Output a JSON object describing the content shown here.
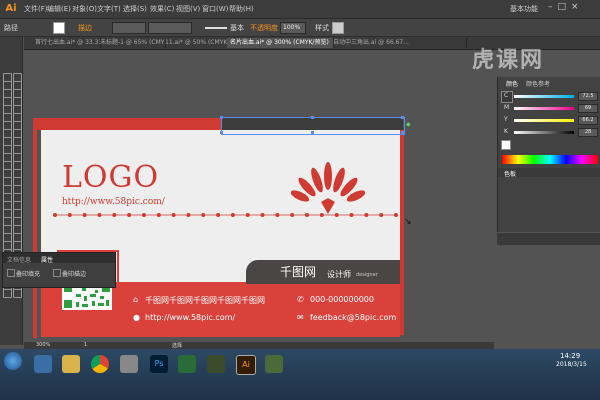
{
  "app": {
    "logo_text": "Ai",
    "workspace": "基本功能"
  },
  "menu": [
    "文件(F)",
    "编辑(E)",
    "对象(O)",
    "文字(T)",
    "选择(S)",
    "效果(C)",
    "视图(V)",
    "窗口(W)",
    "帮助(H)"
  ],
  "controlbar": {
    "selection_label": "路径",
    "stroke_label": "描边",
    "stroke_style": "基本",
    "opacity_label": "不透明度",
    "opacity_value": "100%",
    "style_label": "样式"
  },
  "tabs": [
    {
      "label": "首行七出血.ai* @ 33.33...",
      "active": false
    },
    {
      "label": "未标题-1 @ 65% (CMYK/...",
      "active": false
    },
    {
      "label": "11.ai* @ 50% (CMYK/预...",
      "active": false
    },
    {
      "label": "名片出血.ai* @ 300% (CMYK/预览)",
      "active": true
    },
    {
      "label": "自动中三角出.ai @ 66.67...",
      "active": false
    }
  ],
  "card": {
    "logo": "LOGO",
    "website": "http://www.58pic.com/",
    "brand": "千图网",
    "title_cn": "设计师",
    "title_en": "designer",
    "address": "千图网千图网千图网千图网千图网",
    "phone": "000-000000000",
    "url": "http://www.58pic.com/",
    "email": "feedback@58pic.com"
  },
  "colors": {
    "accent": "#cf3a33",
    "dark": "#4a4646",
    "background": "#eeeeee"
  },
  "layers_panel": {
    "tab1": "文档信息",
    "tab2": "属性",
    "item1": "叠印填充",
    "item2": "叠印描边"
  },
  "color_panel": {
    "tab1": "颜色",
    "tab2": "颜色参考",
    "channels": [
      {
        "label": "C",
        "value": "72.5",
        "color": "#00aeef"
      },
      {
        "label": "M",
        "value": "69",
        "color": "#ec008c"
      },
      {
        "label": "Y",
        "value": "66.2",
        "color": "#fff200"
      },
      {
        "label": "K",
        "value": "28",
        "color": "#000000"
      }
    ]
  },
  "swatches_panel": {
    "tab": "色板"
  },
  "status": {
    "zoom": "300%",
    "page": "1",
    "mode": "选择"
  },
  "watermark": "虎课网",
  "taskbar": {
    "time": "14:29",
    "date": "2018/3/15",
    "app_ps_label": "Ps",
    "app_ai_label": "Ai"
  }
}
